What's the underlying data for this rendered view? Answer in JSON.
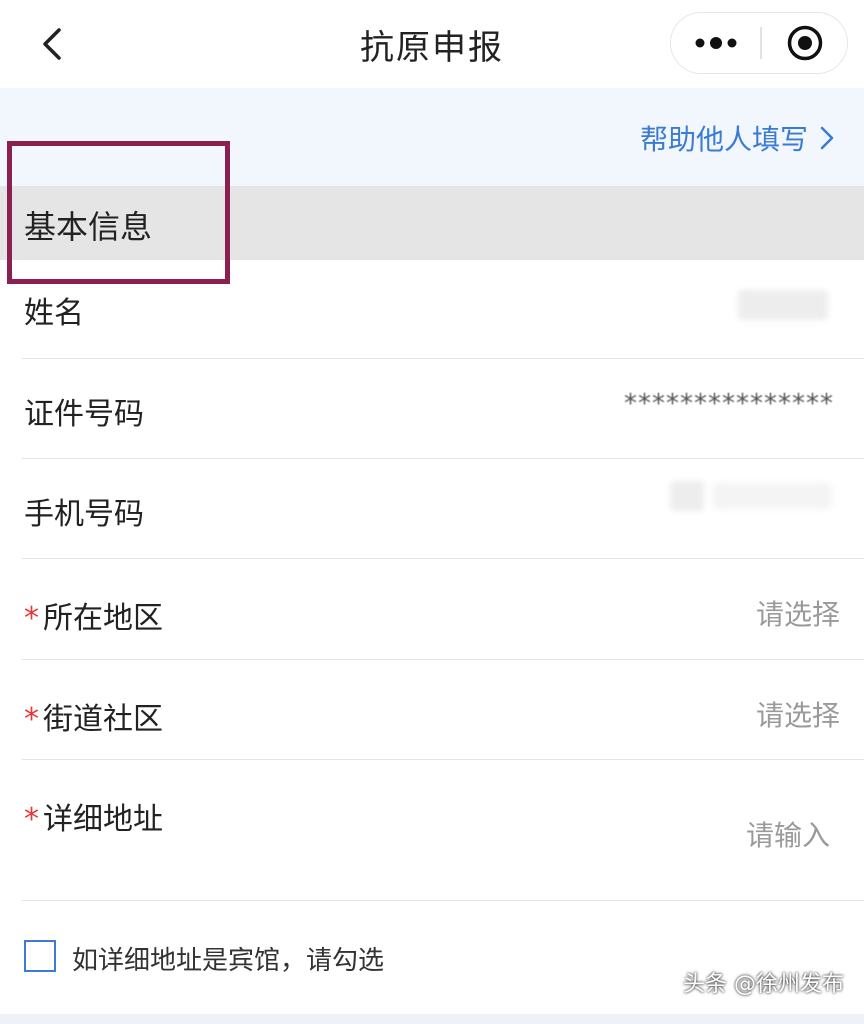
{
  "navbar": {
    "title": "抗原申报",
    "back_icon": "chevron-left-icon",
    "more_icon": "more-dots-icon",
    "close_icon": "target-close-icon"
  },
  "help_link": {
    "label": "帮助他人填写"
  },
  "section": {
    "title": "基本信息"
  },
  "fields": {
    "name": {
      "label": "姓名"
    },
    "id_number": {
      "label": "证件号码",
      "value": "***************"
    },
    "phone": {
      "label": "手机号码"
    },
    "region": {
      "required_mark": "*",
      "label": "所在地区",
      "placeholder": "请选择"
    },
    "street": {
      "required_mark": "*",
      "label": "街道社区",
      "placeholder": "请选择"
    },
    "address": {
      "required_mark": "*",
      "label": "详细地址",
      "placeholder": "请输入"
    }
  },
  "hotel_checkbox": {
    "label": "如详细地址是宾馆，请勾选",
    "checked": false
  },
  "watermark": "头条 @徐州发布",
  "colors": {
    "accent": "#3a7bd5",
    "required": "#e53935",
    "highlight_box": "#8b1f4f",
    "help_bar_bg": "#f2f6fd",
    "section_bg": "#e5e5e5"
  }
}
